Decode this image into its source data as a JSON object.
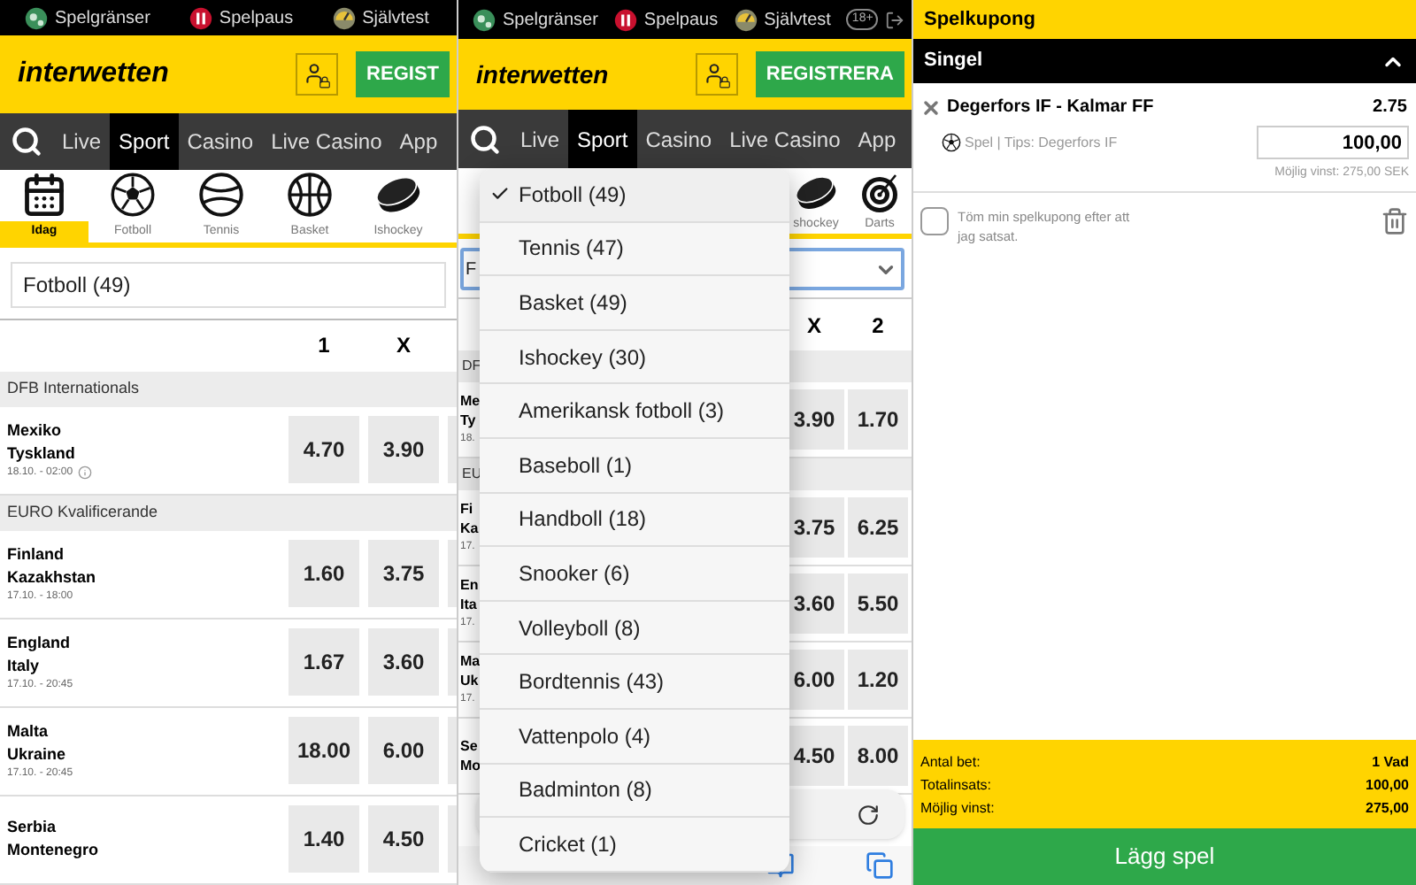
{
  "sport_screen": {
    "safety_bar": [
      {
        "label": "Spelgränser",
        "kind": "limits"
      },
      {
        "label": "Spelpaus",
        "kind": "pause"
      },
      {
        "label": "Självtest",
        "kind": "test"
      }
    ],
    "logo": "interwetten",
    "register_button": "REGIST",
    "nav": [
      {
        "label": "Live",
        "selected": false
      },
      {
        "label": "Sport",
        "selected": true
      },
      {
        "label": "Casino",
        "selected": false
      },
      {
        "label": "Live Casino",
        "selected": false
      },
      {
        "label": "App",
        "selected": false
      }
    ],
    "sports": [
      {
        "label": "Idag",
        "kind": "calendar",
        "selected": true
      },
      {
        "label": "Fotboll",
        "kind": "football",
        "selected": false
      },
      {
        "label": "Tennis",
        "kind": "tennis",
        "selected": false
      },
      {
        "label": "Basket",
        "kind": "basket",
        "selected": false
      },
      {
        "label": "Ishockey",
        "kind": "hockey",
        "selected": false
      }
    ],
    "sport_select": "Fotboll (49)",
    "columns": [
      "1",
      "X"
    ],
    "groups": [
      {
        "name": "DFB Internationals",
        "matches": [
          {
            "home": "Mexiko",
            "away": "Tyskland",
            "time": "18.10. - 02:00",
            "info": true,
            "odds": [
              "4.70",
              "3.90"
            ]
          }
        ]
      },
      {
        "name": "EURO Kvalificerande",
        "matches": [
          {
            "home": "Finland",
            "away": "Kazakhstan",
            "time": "17.10. - 18:00",
            "info": false,
            "odds": [
              "1.60",
              "3.75"
            ]
          },
          {
            "home": "England",
            "away": "Italy",
            "time": "17.10. - 20:45",
            "info": false,
            "odds": [
              "1.67",
              "3.60"
            ]
          },
          {
            "home": "Malta",
            "away": "Ukraine",
            "time": "17.10. - 20:45",
            "info": false,
            "odds": [
              "18.00",
              "6.00"
            ]
          },
          {
            "home": "Serbia",
            "away": "Montenegro",
            "info": false,
            "odds": [
              "1.40",
              "4.50"
            ]
          }
        ]
      }
    ]
  },
  "dropdown_screen": {
    "safety_bar": [
      {
        "label": "Spelgränser",
        "kind": "limits"
      },
      {
        "label": "Spelpaus",
        "kind": "pause"
      },
      {
        "label": "Självtest",
        "kind": "test"
      }
    ],
    "age_badge": "18+",
    "logo": "interwetten",
    "register_button": "REGISTRERA",
    "nav": [
      {
        "label": "Live",
        "selected": false
      },
      {
        "label": "Sport",
        "selected": true
      },
      {
        "label": "Casino",
        "selected": false
      },
      {
        "label": "Live Casino",
        "selected": false
      },
      {
        "label": "App",
        "selected": false
      }
    ],
    "sports": [
      {
        "label": "shockey",
        "kind": "hockey"
      },
      {
        "label": "Darts",
        "kind": "darts"
      }
    ],
    "sport_select": "F",
    "columns": [
      "X",
      "2"
    ],
    "rows": [
      {
        "kind": "group",
        "text": "DF"
      },
      {
        "kind": "match",
        "lines": [
          "Me",
          "Ty",
          "18."
        ],
        "odds": [
          "3.90",
          "1.70"
        ]
      },
      {
        "kind": "group",
        "text": "EU"
      },
      {
        "kind": "match",
        "lines": [
          "Fi",
          "Ka",
          "17."
        ],
        "odds": [
          "3.75",
          "6.25"
        ]
      },
      {
        "kind": "match",
        "lines": [
          "En",
          "Ita",
          "17."
        ],
        "odds": [
          "3.60",
          "5.50"
        ]
      },
      {
        "kind": "match",
        "lines": [
          "Ma",
          "Uk",
          "17."
        ],
        "odds": [
          "6.00",
          "1.20"
        ]
      },
      {
        "kind": "match",
        "lines": [
          "Se",
          "Mo"
        ],
        "odds": [
          "4.50",
          "8.00"
        ]
      }
    ],
    "dropdown": [
      {
        "label": "Fotboll (49)",
        "selected": true
      },
      {
        "label": "Tennis (47)",
        "selected": false
      },
      {
        "label": "Basket (49)",
        "selected": false
      },
      {
        "label": "Ishockey (30)",
        "selected": false
      },
      {
        "label": "Amerikansk fotboll (3)",
        "selected": false
      },
      {
        "label": "Baseboll (1)",
        "selected": false
      },
      {
        "label": "Handboll (18)",
        "selected": false
      },
      {
        "label": "Snooker (6)",
        "selected": false
      },
      {
        "label": "Volleyboll (8)",
        "selected": false
      },
      {
        "label": "Bordtennis (43)",
        "selected": false
      },
      {
        "label": "Vattenpolo (4)",
        "selected": false
      },
      {
        "label": "Badminton (8)",
        "selected": false
      },
      {
        "label": "Cricket (1)",
        "selected": false
      }
    ]
  },
  "betslip": {
    "title": "Spelkupong",
    "section": "Singel",
    "expanded": true,
    "bet": {
      "match": "Degerfors IF - Kalmar FF",
      "odds": "2.75",
      "tip": "Spel | Tips: Degerfors IF",
      "stake": "100,00",
      "possible_win": "Möjlig vinst: 275,00 SEK"
    },
    "clear_option": {
      "label": "Töm min spelkupong efter att jag satsat.",
      "checked": false
    },
    "summary": [
      {
        "label": "Antal bet:",
        "value": "1 Vad"
      },
      {
        "label": "Totalinsats:",
        "value": "100,00"
      },
      {
        "label": "Möjlig vinst:",
        "value": "275,00"
      }
    ],
    "submit": "Lägg spel"
  }
}
